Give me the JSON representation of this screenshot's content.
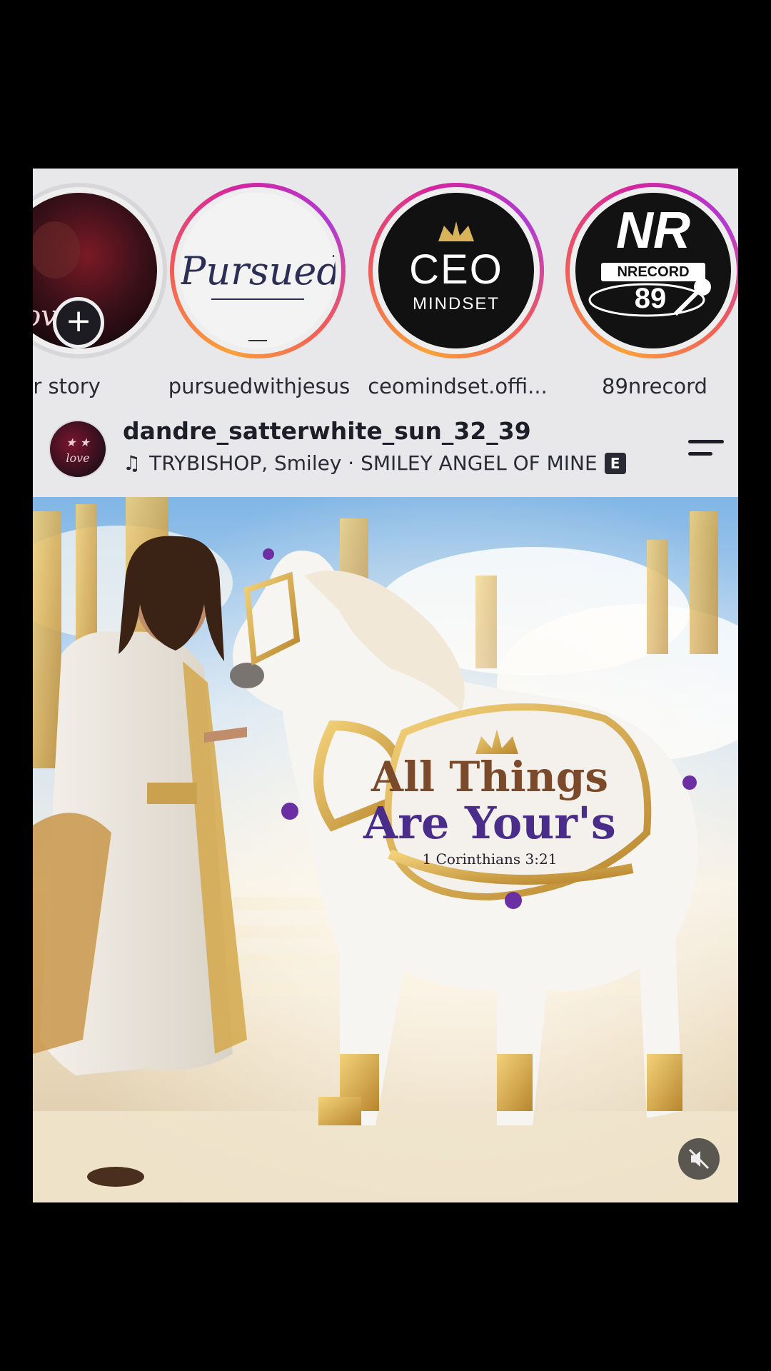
{
  "stories": [
    {
      "label": "ur story",
      "has_add": true
    },
    {
      "label": "pursuedwithjesus",
      "logo_text": "Pursued"
    },
    {
      "label": "ceomindset.offi...",
      "logo_line1": "CEO",
      "logo_line2": "MINDSET"
    },
    {
      "label": "89nrecord",
      "logo_line1": "NR",
      "logo_line2": "NRECORD",
      "logo_line3": "89"
    }
  ],
  "post": {
    "username": "dandre_satterwhite_sun_32_39",
    "music": "TRYBISHOP, Smiley · SMILEY ANGEL OF MINE",
    "explicit_badge": "E",
    "avatar_text": "love",
    "image": {
      "title_line1": "All Things",
      "title_line2": "Are Your's",
      "verse": "1 Corinthians 3:21"
    }
  },
  "colors": {
    "story_ring": "#d6249f",
    "gold": "#d4a84b",
    "purple": "#4a2c8a",
    "brown": "#7b4a2a"
  }
}
